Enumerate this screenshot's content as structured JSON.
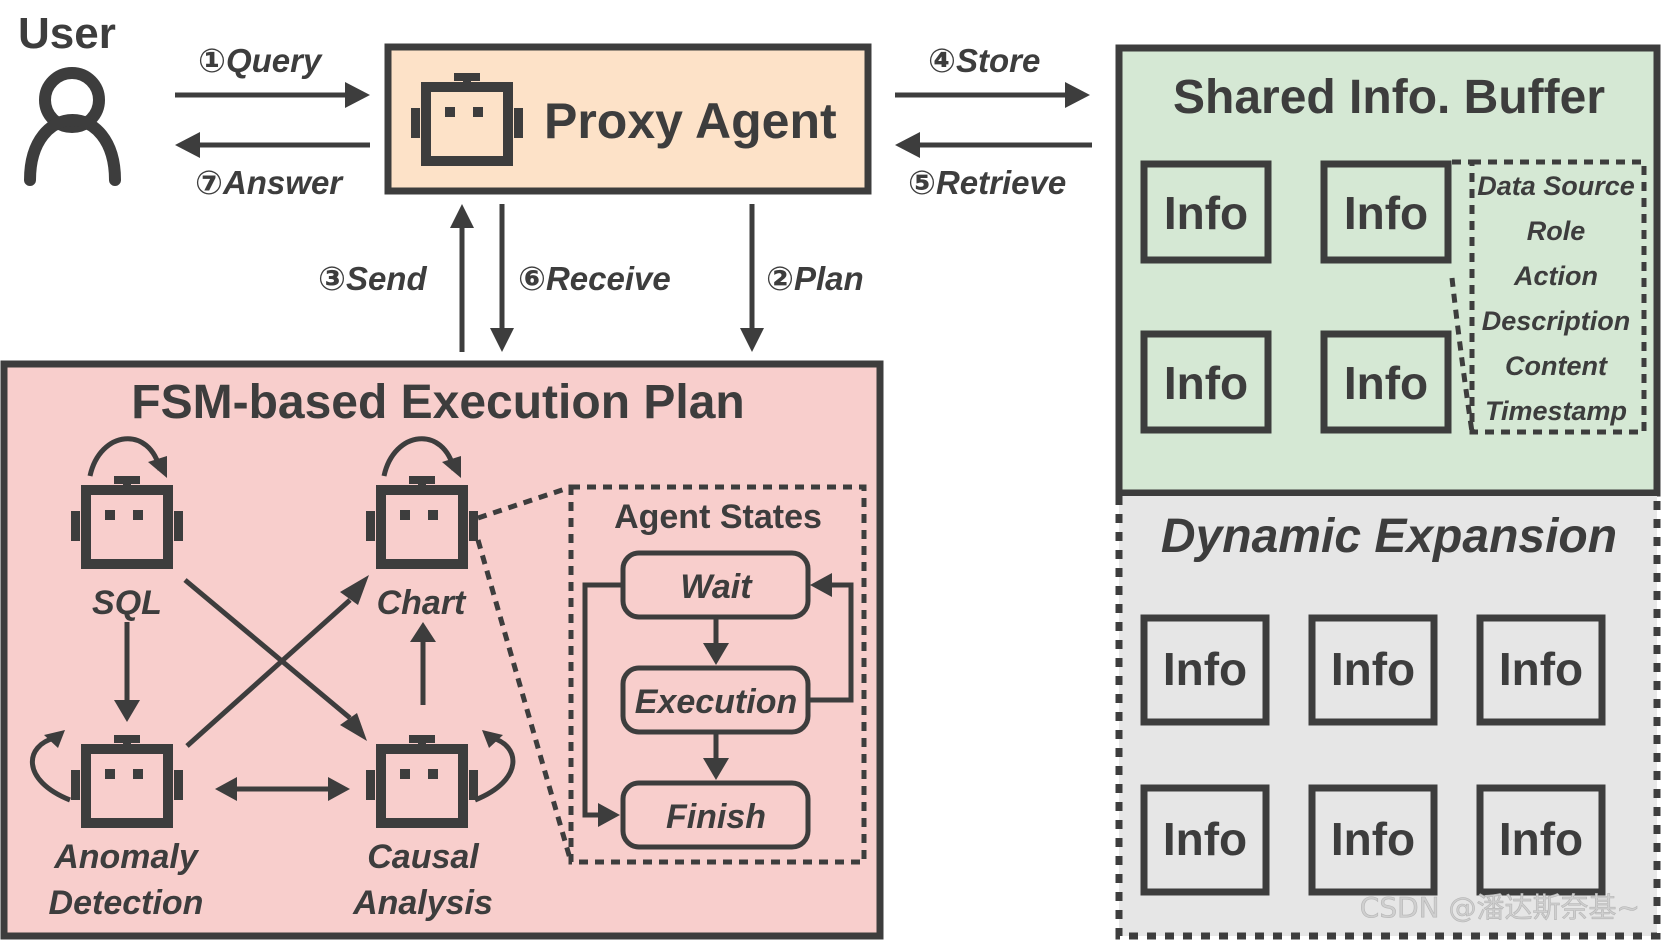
{
  "user": {
    "label": "User"
  },
  "proxy_agent": {
    "label": "Proxy Agent",
    "fill": "#fde2c8"
  },
  "flows": {
    "query": "①Query",
    "answer": "⑦Answer",
    "store": "④Store",
    "retrieve": "⑤Retrieve",
    "send": "③Send",
    "receive": "⑥Receive",
    "plan": "②Plan"
  },
  "shared_buffer": {
    "title": "Shared Info. Buffer",
    "fill": "#d5e8d4",
    "items": [
      "Info",
      "Info",
      "Info",
      "Info"
    ],
    "fields": [
      "Data Source",
      "Role",
      "Action",
      "Description",
      "Content",
      "Timestamp"
    ]
  },
  "dynamic_expansion": {
    "title": "Dynamic Expansion",
    "fill": "#e6e6e6",
    "items": [
      "Info",
      "Info",
      "Info",
      "Info",
      "Info",
      "Info"
    ]
  },
  "fsm_plan": {
    "title": "FSM-based Execution Plan",
    "fill": "#f8cecc",
    "agents": {
      "sql": "SQL",
      "chart": "Chart",
      "anomaly_1": "Anomaly",
      "anomaly_2": "Detection",
      "causal_1": "Causal",
      "causal_2": "Analysis"
    },
    "agent_states": {
      "title": "Agent States",
      "states": [
        "Wait",
        "Execution",
        "Finish"
      ]
    }
  },
  "watermark": "CSDN @潘达斯奈基~",
  "colors": {
    "stroke": "#3d3d3d"
  }
}
